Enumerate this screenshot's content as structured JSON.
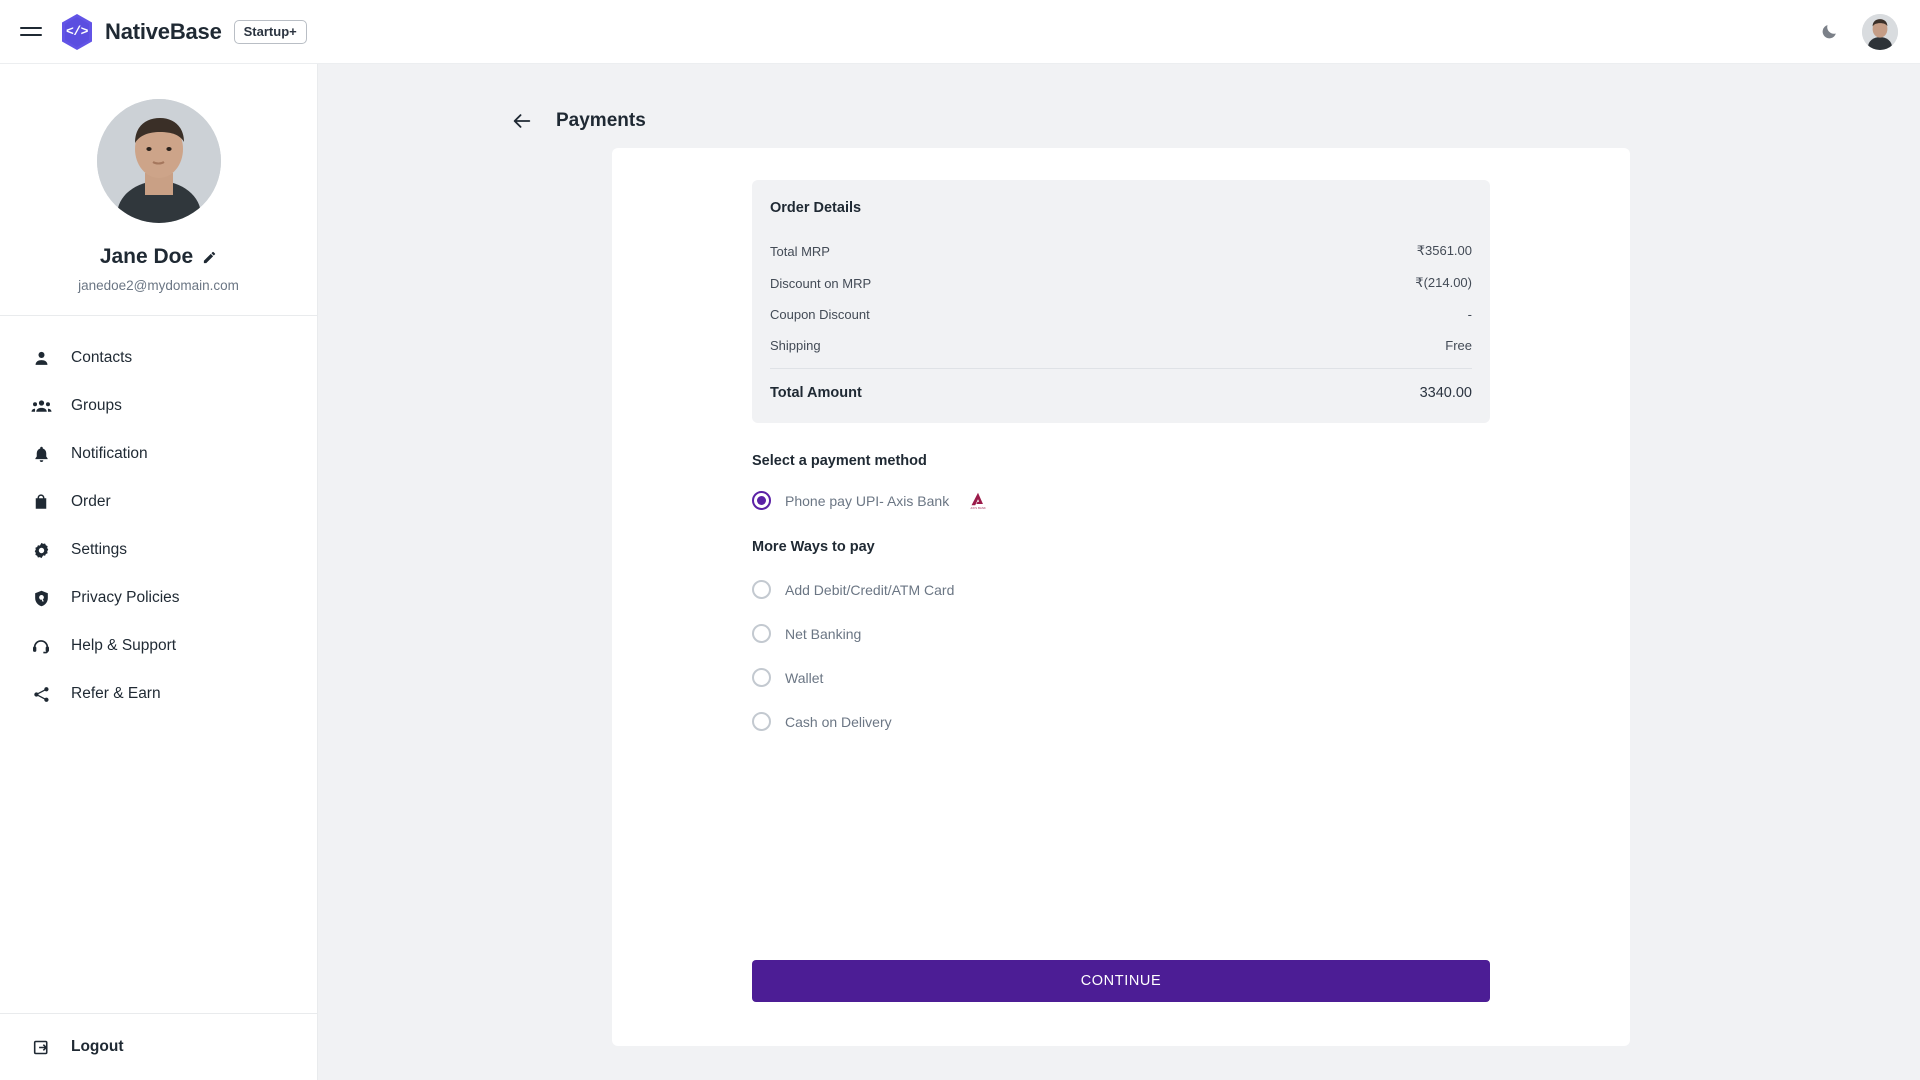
{
  "topbar": {
    "menu_icon": "hamburger-menu-icon",
    "logo_icon": "nativebase-hexagon-logo",
    "logo_glyph": "</>",
    "brand": "NativeBase",
    "badge": "Startup+",
    "theme_toggle_icon": "moon-icon",
    "avatar_icon": "user-avatar"
  },
  "sidebar": {
    "profile": {
      "avatar_icon": "profile-avatar",
      "name": "Jane Doe",
      "edit_icon": "pencil-icon",
      "email": "janedoe2@mydomain.com"
    },
    "items": [
      {
        "label": "Contacts",
        "icon": "person-icon"
      },
      {
        "label": "Groups",
        "icon": "people-icon"
      },
      {
        "label": "Notification",
        "icon": "bell-icon"
      },
      {
        "label": "Order",
        "icon": "shopping-bag-icon"
      },
      {
        "label": "Settings",
        "icon": "gear-icon"
      },
      {
        "label": "Privacy Policies",
        "icon": "shield-icon"
      },
      {
        "label": "Help & Support",
        "icon": "headset-icon"
      },
      {
        "label": "Refer & Earn",
        "icon": "share-icon"
      }
    ],
    "logout": {
      "label": "Logout",
      "icon": "logout-icon"
    }
  },
  "main": {
    "back_icon": "arrow-left-icon",
    "title": "Payments",
    "order_details": {
      "title": "Order Details",
      "rows": [
        {
          "label": "Total MRP",
          "value": "₹3561.00"
        },
        {
          "label": "Discount on MRP",
          "value": "₹(214.00)"
        },
        {
          "label": "Coupon Discount",
          "value": "-"
        },
        {
          "label": "Shipping",
          "value": "Free"
        }
      ],
      "total_label": "Total Amount",
      "total_value": "3340.00"
    },
    "select_method_title": "Select a payment method",
    "selected_method": {
      "label": "Phone pay UPI- Axis Bank",
      "bank_logo_icon": "axis-bank-logo",
      "bank_logo_text": "AXIS BANK",
      "selected": true
    },
    "more_ways_title": "More Ways to pay",
    "more_options": [
      {
        "label": "Add Debit/Credit/ATM Card"
      },
      {
        "label": "Net Banking"
      },
      {
        "label": "Wallet"
      },
      {
        "label": "Cash on Delivery"
      }
    ],
    "continue_label": "CONTINUE"
  },
  "colors": {
    "brand_purple": "#5b50e0",
    "accent_purple": "#5b21a6",
    "button_purple": "#4c1d95",
    "page_bg": "#f1f2f4",
    "axis_maroon": "#9b1b4a",
    "text_dark": "#1f2933",
    "text_muted": "#6b7684"
  }
}
